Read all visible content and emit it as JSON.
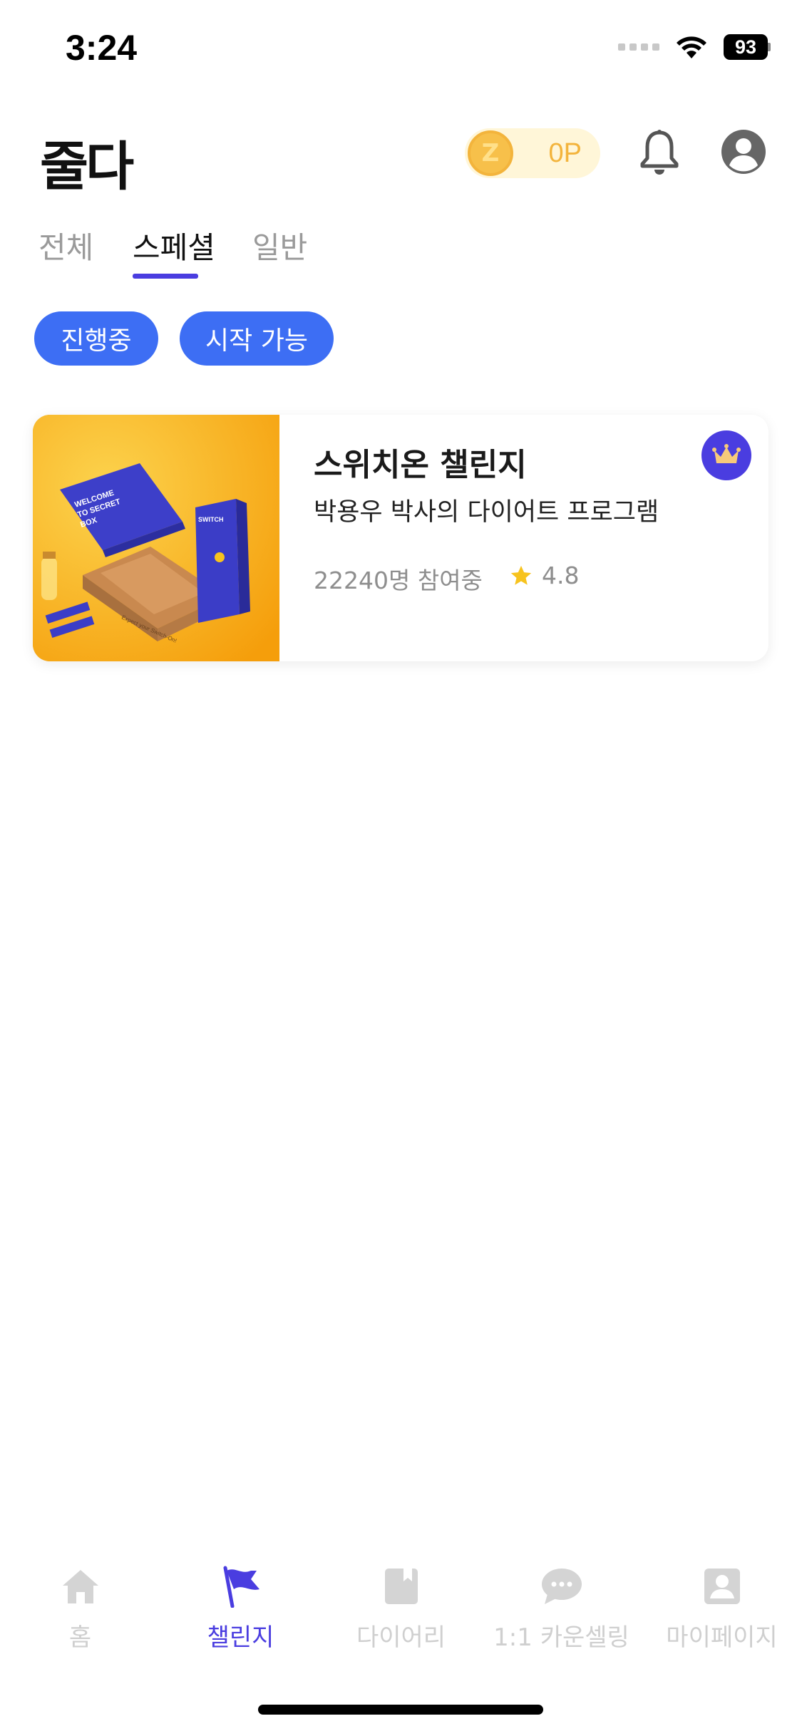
{
  "status_bar": {
    "time": "3:24",
    "battery": "93"
  },
  "header": {
    "logo": "줄다",
    "points": "0P",
    "coin_letter": "Z"
  },
  "tabs": [
    {
      "label": "전체",
      "active": false
    },
    {
      "label": "스페셜",
      "active": true
    },
    {
      "label": "일반",
      "active": false
    }
  ],
  "filters": [
    {
      "label": "진행중"
    },
    {
      "label": "시작 가능"
    }
  ],
  "challenge_card": {
    "title": "스위치온 챌린지",
    "subtitle": "박용우 박사의 다이어트 프로그램",
    "participants": "22240명 참여중",
    "rating": "4.8",
    "image": {
      "box_text": "WELCOME TO SECRET BOX",
      "product_text": "SWITCH ON",
      "tagline": "Expect your Switch-On!"
    },
    "badge_icon": "crown-icon"
  },
  "bottom_nav": [
    {
      "label": "홈",
      "icon": "home-icon",
      "active": false
    },
    {
      "label": "챌린지",
      "icon": "flag-icon",
      "active": true
    },
    {
      "label": "다이어리",
      "icon": "diary-icon",
      "active": false
    },
    {
      "label": "1:1 카운셀링",
      "icon": "chat-icon",
      "active": false
    },
    {
      "label": "마이페이지",
      "icon": "person-icon",
      "active": false
    }
  ],
  "colors": {
    "accent": "#4a3de0",
    "chip": "#3d6ef4",
    "coin": "#f3b43c",
    "star": "#f7c31e"
  }
}
